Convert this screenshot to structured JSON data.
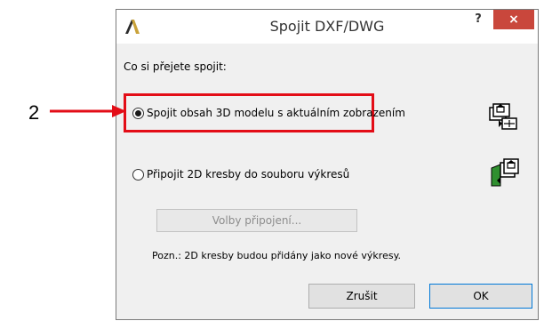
{
  "dialog": {
    "title": "Spojit DXF/DWG",
    "help_label": "?",
    "close_label": "×",
    "prompt": "Co si přejete spojit:",
    "options": [
      {
        "label": "Spojit obsah 3D modelu s aktuálním zobrazením",
        "selected": true,
        "icon": "merge-model-icon"
      },
      {
        "label": "Připojit 2D kresby do souboru výkresů",
        "selected": false,
        "icon": "attach-drawings-icon"
      }
    ],
    "connect_options_label": "Volby připojení...",
    "note": "Pozn.: 2D kresby budou přidány jako nové výkresy.",
    "cancel_label": "Zrušit",
    "ok_label": "OK"
  },
  "annotation": {
    "number": "2",
    "color": "#e30d17"
  },
  "colors": {
    "close_button": "#c9473c",
    "dialog_body": "#f0f0f0",
    "ok_border": "#0078d7"
  }
}
